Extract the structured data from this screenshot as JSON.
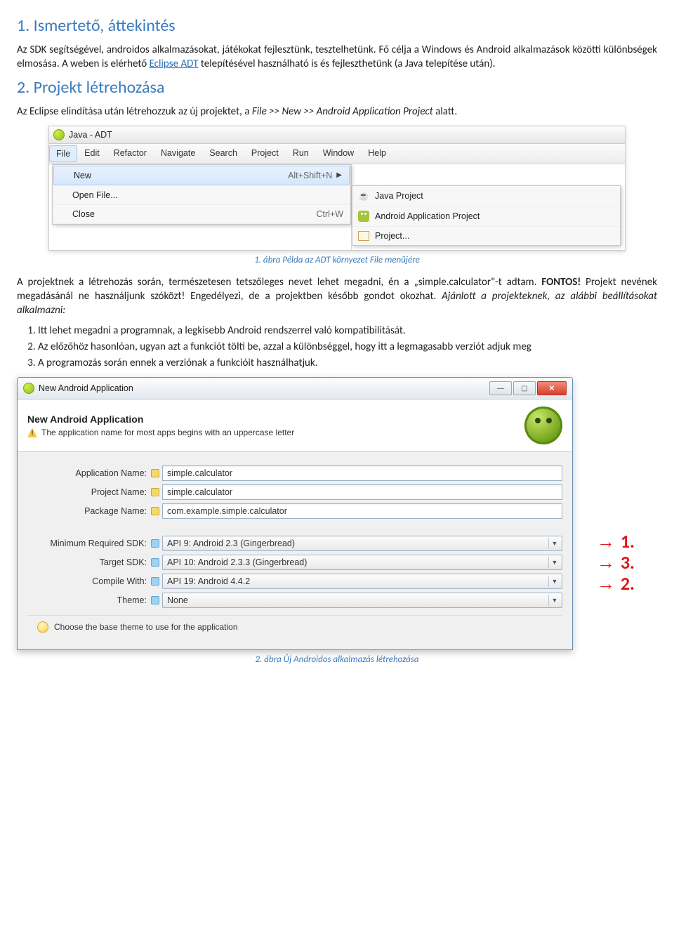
{
  "s1": {
    "title": "1. Ismertető, áttekintés",
    "p1a": "Az SDK segítségével, androidos alkalmazásokat, játékokat fejlesztünk, tesztelhetünk. Fő célja a Windows és Android alkalmazások közötti különbségek elmosása. A weben is elérhető ",
    "link": "Eclipse ADT",
    "p1b": " telepítésével használható is és fejleszthetünk (a Java telepítése után)."
  },
  "s2": {
    "title": "2. Projekt létrehozása",
    "p1": "Az Eclipse elindítása után létrehozzuk az új projektet, a ",
    "path": "File >> New >> Android Application Project",
    "p1b": " alatt."
  },
  "shot1": {
    "title": "Java - ADT",
    "menus": [
      "File",
      "Edit",
      "Refactor",
      "Navigate",
      "Search",
      "Project",
      "Run",
      "Window",
      "Help"
    ],
    "left": [
      {
        "label": "New",
        "shortcut": "Alt+Shift+N",
        "arrow": true,
        "selected": true
      },
      {
        "label": "Open File..."
      },
      {
        "label": "Close",
        "shortcut": "Ctrl+W"
      }
    ],
    "right": [
      {
        "label": "Java Project"
      },
      {
        "label": "Android Application Project"
      },
      {
        "label": "Project..."
      }
    ]
  },
  "cap1": "1. ábra Példa az ADT környezet File menüjére",
  "mid": {
    "p1a": "A projektnek a létrehozás során, természetesen tetszőleges nevet lehet megadni, én a „simple.calculator\"-t adtam. ",
    "fontos": "FONTOS!",
    "p1b": " Projekt nevének megadásánál ne használjunk szóközt! Engedélyezi, de a projektben később gondot okozhat. ",
    "p1c": "Ajánlott a projekteknek, az alábbi beállításokat alkalmazni:",
    "list": [
      "Itt lehet megadni a programnak, a legkisebb Android rendszerrel való kompatibilitását.",
      "Az előzőhöz hasonlóan, ugyan azt a funkciót tölti be, azzal a különbséggel, hogy itt a legmagasabb verziót adjuk meg",
      "A programozás során ennek a verziónak a funkcióit használhatjuk."
    ]
  },
  "shot2": {
    "titlebar": "New Android Application",
    "heading": "New Android Application",
    "warning": "The application name for most apps begins with an uppercase letter",
    "rows": {
      "appName": {
        "label": "Application Name:",
        "value": "simple.calculator"
      },
      "projName": {
        "label": "Project Name:",
        "value": "simple.calculator"
      },
      "pkgName": {
        "label": "Package Name:",
        "value": "com.example.simple.calculator"
      },
      "minSDK": {
        "label": "Minimum Required SDK:",
        "value": "API 9: Android 2.3 (Gingerbread)"
      },
      "targetSDK": {
        "label": "Target SDK:",
        "value": "API 10: Android 2.3.3 (Gingerbread)"
      },
      "compile": {
        "label": "Compile With:",
        "value": "API 19: Android 4.4.2"
      },
      "theme": {
        "label": "Theme:",
        "value": "None"
      }
    },
    "hint": "Choose the base theme to use for the application"
  },
  "annot": {
    "a1": "1.",
    "a2": "3.",
    "a3": "2."
  },
  "cap2": "2. ábra Új Androidos alkalmazás létrehozása"
}
